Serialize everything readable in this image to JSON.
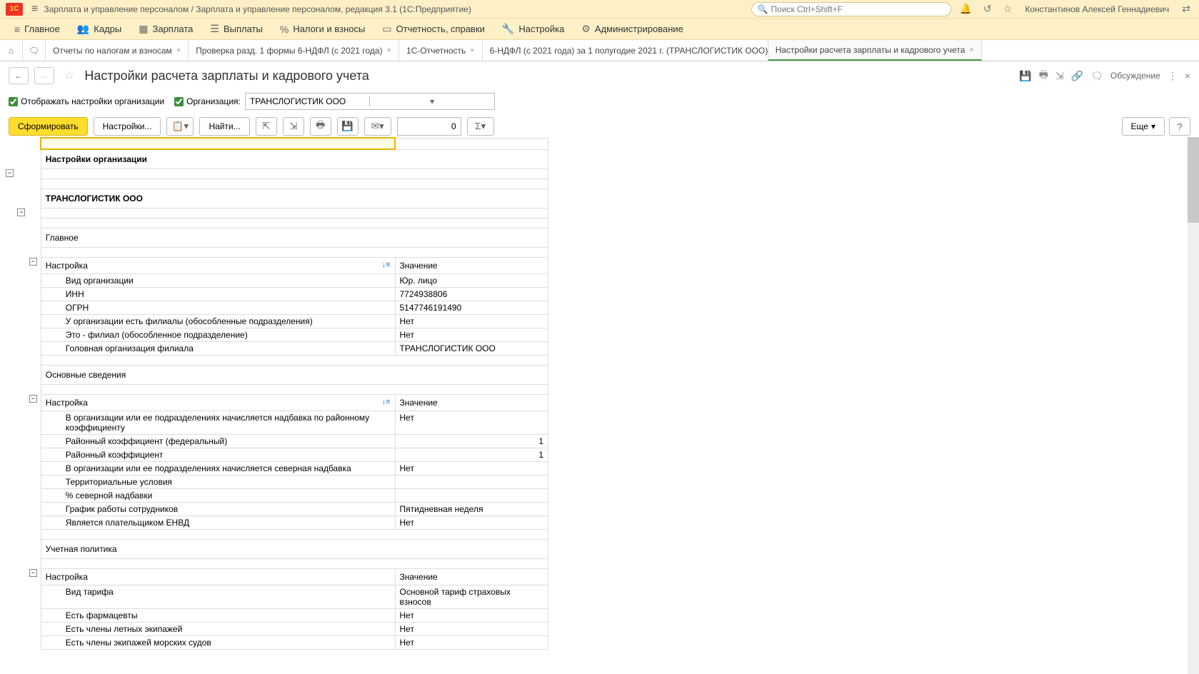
{
  "titlebar": {
    "app_title": "Зарплата и управление персоналом / Зарплата и управление персоналом, редакция 3.1  (1С:Предприятие)",
    "search_placeholder": "Поиск Ctrl+Shift+F",
    "user": "Константинов Алексей Геннадиевич"
  },
  "mainnav": [
    {
      "icon": "≡",
      "label": "Главное"
    },
    {
      "icon": "👥",
      "label": "Кадры"
    },
    {
      "icon": "▦",
      "label": "Зарплата"
    },
    {
      "icon": "☰",
      "label": "Выплаты"
    },
    {
      "icon": "%",
      "label": "Налоги и взносы"
    },
    {
      "icon": "▭",
      "label": "Отчетность, справки"
    },
    {
      "icon": "🔧",
      "label": "Настройка"
    },
    {
      "icon": "⚙",
      "label": "Администрирование"
    }
  ],
  "tabs": [
    {
      "label": "Отчеты по налогам и взносам",
      "active": false
    },
    {
      "label": "Проверка разд. 1 формы 6-НДФЛ (с 2021 года)",
      "active": false
    },
    {
      "label": "1С-Отчетность",
      "active": false
    },
    {
      "label": "6-НДФЛ (с 2021 года) за 1 полугодие 2021 г. (ТРАНСЛОГИСТИК ООО) *",
      "active": false
    },
    {
      "label": "Настройки расчета зарплаты и кадрового учета",
      "active": true
    }
  ],
  "page": {
    "title": "Настройки расчета зарплаты и кадрового учета",
    "discuss": "Обсуждение"
  },
  "filter": {
    "show_org_settings": "Отображать настройки организации",
    "org_label": "Организация:",
    "org_value": "ТРАНСЛОГИСТИК ООО"
  },
  "toolbar": {
    "form": "Сформировать",
    "settings": "Настройки...",
    "find": "Найти...",
    "num": "0",
    "more": "Еще"
  },
  "report": {
    "h_org_settings": "Настройки организации",
    "org_name": "ТРАНСЛОГИСТИК ООО",
    "sec_main": "Главное",
    "col_setting": "Настройка",
    "col_value": "Значение",
    "main_rows": [
      {
        "k": "Вид организации",
        "v": "Юр. лицо"
      },
      {
        "k": "ИНН",
        "v": "7724938806"
      },
      {
        "k": "ОГРН",
        "v": "5147746191490"
      },
      {
        "k": "У организации есть филиалы (обособленные подразделения)",
        "v": "Нет"
      },
      {
        "k": "Это - филиал (обособленное подразделение)",
        "v": "Нет"
      },
      {
        "k": "Головная организация филиала",
        "v": "ТРАНСЛОГИСТИК ООО"
      }
    ],
    "sec_basic": "Основные сведения",
    "basic_rows": [
      {
        "k": "В организации или ее подразделениях начисляется надбавка по районному коэффициенту",
        "v": "Нет"
      },
      {
        "k": "Районный коэффициент (федеральный)",
        "v": "1",
        "r": true
      },
      {
        "k": "Районный коэффициент",
        "v": "1",
        "r": true
      },
      {
        "k": "В организации или ее подразделениях начисляется северная надбавка",
        "v": "Нет"
      },
      {
        "k": "Территориальные условия",
        "v": ""
      },
      {
        "k": "% северной надбавки",
        "v": ""
      },
      {
        "k": "График работы сотрудников",
        "v": "Пятидневная неделя"
      },
      {
        "k": "Является плательщиком ЕНВД",
        "v": "Нет"
      }
    ],
    "sec_policy": "Учетная политика",
    "policy_rows": [
      {
        "k": "Вид тарифа",
        "v": "Основной тариф страховых взносов"
      },
      {
        "k": "Есть фармацевты",
        "v": "Нет"
      },
      {
        "k": "Есть члены летных экипажей",
        "v": "Нет"
      },
      {
        "k": "Есть члены экипажей морских судов",
        "v": "Нет"
      }
    ]
  }
}
